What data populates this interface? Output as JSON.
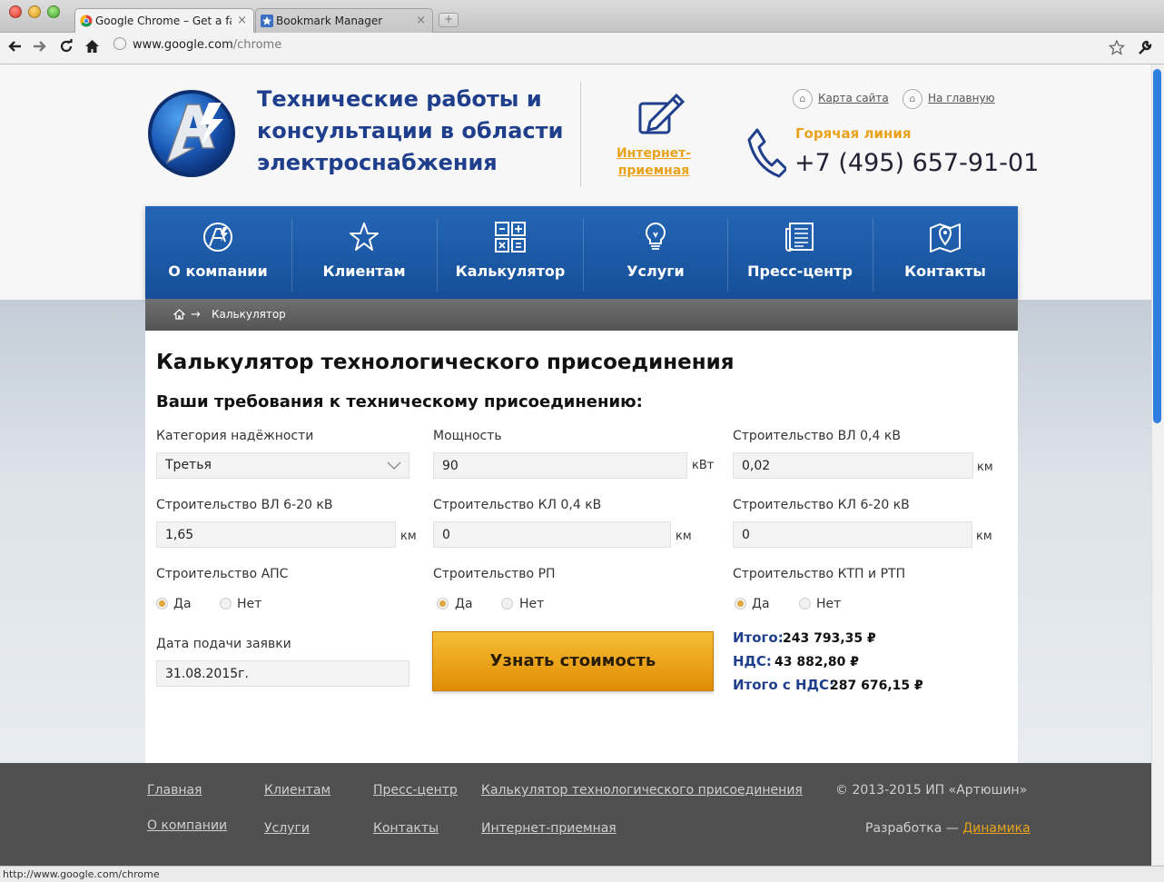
{
  "browser": {
    "tabs": [
      {
        "title": "Google Chrome – Get a fast",
        "close": "×"
      },
      {
        "title": "Bookmark Manager",
        "close": "×"
      }
    ],
    "new_tab": "+",
    "url_host": "www.google.com",
    "url_path": "/chrome",
    "status_url": "http://www.google.com/chrome"
  },
  "header": {
    "title": "Технические работы и консультации в области электроснабжения",
    "reception": "Интернет-приемная",
    "sitemap": "Карта сайта",
    "home": "На главную",
    "hotline_label": "Горячая линия",
    "phone": "+7 (495) 657-91-01"
  },
  "nav": {
    "items": [
      {
        "label": "О компании",
        "icon": "company-logo-icon"
      },
      {
        "label": "Клиентам",
        "icon": "star-icon"
      },
      {
        "label": "Калькулятор",
        "icon": "calculator-icon"
      },
      {
        "label": "Услуги",
        "icon": "lightbulb-icon"
      },
      {
        "label": "Пресс-центр",
        "icon": "newspaper-icon"
      },
      {
        "label": "Контакты",
        "icon": "map-pin-icon"
      }
    ]
  },
  "breadcrumb": {
    "arrow": "→",
    "current": "Калькулятор"
  },
  "calculator": {
    "title": "Калькулятор технологического присоединения",
    "subtitle": "Ваши требования к техническому присоединению:",
    "reliability": {
      "label": "Категория надёжности",
      "value": "Третья"
    },
    "power": {
      "label": "Мощность",
      "value": "90",
      "unit": "кВт"
    },
    "vl04": {
      "label": "Строительство ВЛ 0,4 кВ",
      "value": "0,02",
      "unit": "км"
    },
    "vl620": {
      "label": "Строительство ВЛ 6-20 кВ",
      "value": "1,65",
      "unit": "км"
    },
    "kl04": {
      "label": "Строительство КЛ 0,4 кВ",
      "value": "0",
      "unit": "км"
    },
    "kl620": {
      "label": "Строительство КЛ 6-20 кВ",
      "value": "0",
      "unit": "км"
    },
    "aps": {
      "label": "Строительство АПС",
      "yes": "Да",
      "no": "Нет",
      "selected": "yes"
    },
    "rp": {
      "label": "Строительство РП",
      "yes": "Да",
      "no": "Нет",
      "selected": "yes"
    },
    "ktp": {
      "label": "Строительство КТП и РТП",
      "yes": "Да",
      "no": "Нет",
      "selected": "yes"
    },
    "date": {
      "label": "Дата подачи заявки",
      "value": "31.08.2015г."
    },
    "button": "Узнать стоимость",
    "results": {
      "total_label": "Итого:",
      "total": "243 793,35 ₽",
      "vat_label": "НДС:",
      "vat": "43 882,80 ₽",
      "total_vat_label": "Итого с НДС:",
      "total_vat": "287 676,15 ₽"
    }
  },
  "footer": {
    "links": [
      "Главная",
      "О компании",
      "Клиентам",
      "Услуги",
      "Пресс-центр",
      "Контакты",
      "Калькулятор технологического присоединения",
      "Интернет-приемная"
    ],
    "copyright": "© 2013-2015 ИП «Артюшин»",
    "dev_prefix": "Разработка — ",
    "dev_link": "Динамика"
  },
  "colors": {
    "nav_blue": "#1f5ba8",
    "accent_orange": "#e8a21c",
    "title_blue": "#1f3f8c",
    "footer": "#505050"
  }
}
